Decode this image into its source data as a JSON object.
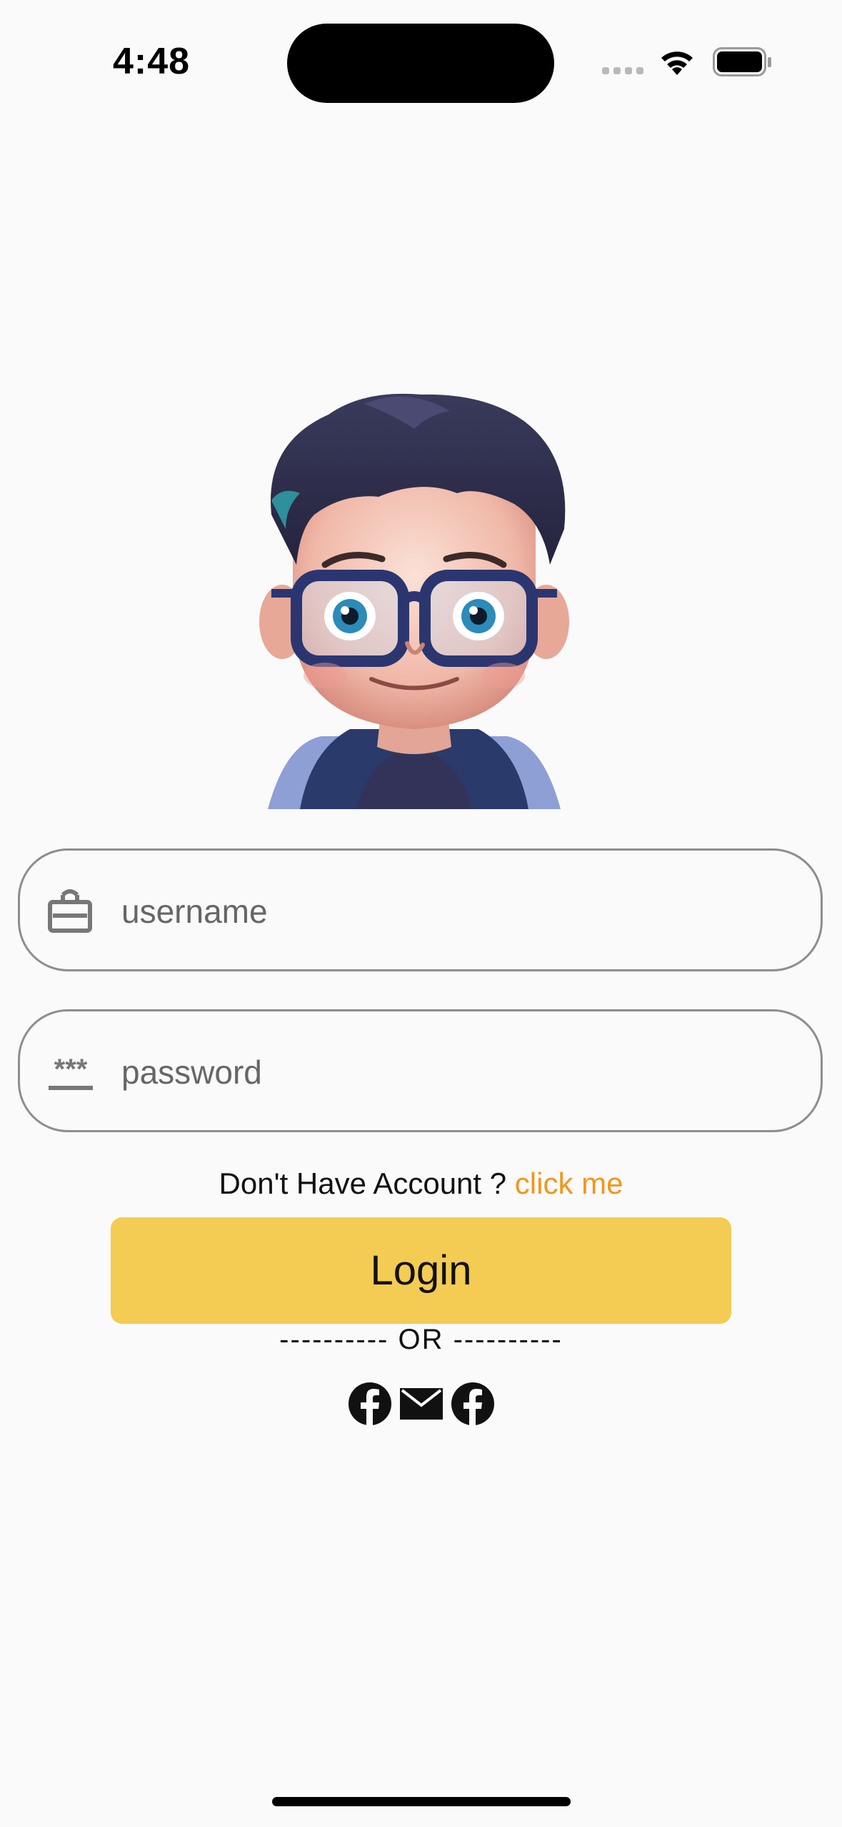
{
  "status_bar": {
    "time": "4:48"
  },
  "avatar": {
    "icon": "cartoon-boy-with-glasses-avatar"
  },
  "form": {
    "username": {
      "value": "",
      "placeholder": "username",
      "icon": "id-badge-icon"
    },
    "password": {
      "value": "",
      "placeholder": "password",
      "icon": "password-icon"
    }
  },
  "signup": {
    "prompt": "Don't Have Account ?",
    "link": "click me",
    "link_color": "#f2961d"
  },
  "login_button": {
    "label": "Login",
    "color": "#f4cb53"
  },
  "separator": "---------- OR ----------",
  "social": [
    {
      "icon": "facebook-icon"
    },
    {
      "icon": "mail-icon"
    },
    {
      "icon": "facebook-icon"
    }
  ],
  "colors": {
    "background": "#fafafa",
    "field_border": "#8e8e8e"
  }
}
